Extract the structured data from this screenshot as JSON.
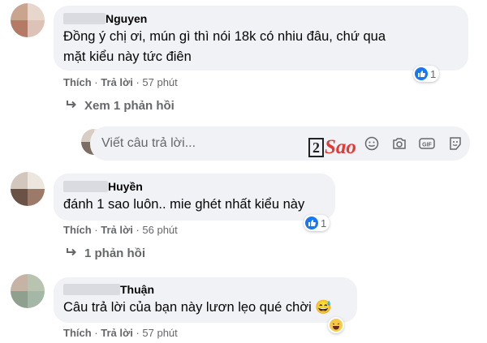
{
  "comments": [
    {
      "name": "Nguyen",
      "lines": [
        "Đồng ý chị ơi, mún gì thì nói 18k có nhiu đâu, chứ qua",
        "mặt kiểu này tức điên"
      ],
      "like_label": "Thích",
      "reply_label": "Trả lời",
      "time": "57 phút",
      "reaction": "like",
      "reaction_count": "1"
    },
    {
      "name": "Huyền",
      "lines": [
        "đánh 1 sao luôn.. mie ghét nhất kiểu này"
      ],
      "like_label": "Thích",
      "reply_label": "Trả lời",
      "time": "56 phút",
      "reaction": "like",
      "reaction_count": "1"
    },
    {
      "name": "Thuận",
      "lines": [
        "Câu trả lời của bạn này lươn lẹo qué chời 😅"
      ],
      "like_label": "Thích",
      "reply_label": "Trả lời",
      "time": "57 phút",
      "reaction": "haha",
      "reaction_count": ""
    }
  ],
  "view_replies": "Xem 1 phản hồi",
  "replies_count": "1 phản hồi",
  "reply_input": {
    "placeholder": "Viết câu trả lời..."
  },
  "watermark": {
    "num": "2",
    "word": "Sao"
  },
  "separator": " · ",
  "icons": {
    "emoji": "smile-icon",
    "camera": "camera-icon",
    "gif": "gif-icon",
    "sticker": "sticker-icon"
  },
  "colors": {
    "like_blue": "#1877f2",
    "bubble": "#f0f2f5",
    "meta": "#65676b",
    "watermark": "#e53935"
  }
}
